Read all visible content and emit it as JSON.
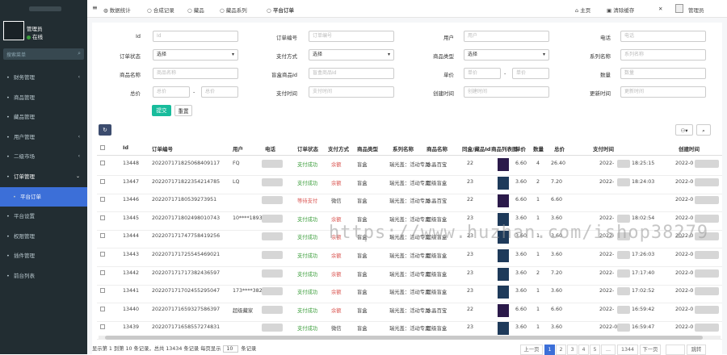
{
  "sidebar": {
    "user_name": "管理员",
    "user_status": "在线",
    "search_placeholder": "搜索菜单",
    "items": [
      {
        "label": "财务管理",
        "icon": "money-icon"
      },
      {
        "label": "商品管理",
        "icon": "goods-icon"
      },
      {
        "label": "藏品管理",
        "icon": "collection-icon"
      },
      {
        "label": "用户管理",
        "icon": "user-icon"
      },
      {
        "label": "二级市场",
        "icon": "market-icon"
      },
      {
        "label": "订单管理",
        "icon": "order-icon"
      },
      {
        "label": "平台订单",
        "icon": "circle-icon"
      },
      {
        "label": "平台设置",
        "icon": "gear-icon"
      },
      {
        "label": "权限管理",
        "icon": "lock-icon"
      },
      {
        "label": "插件管理",
        "icon": "plugin-icon"
      },
      {
        "label": "前台列表",
        "icon": "list-icon"
      }
    ]
  },
  "topbar": {
    "tabs": [
      "数据统计",
      "合成记录",
      "藏品",
      "藏品系列",
      "平台订单"
    ],
    "home": "主页",
    "clear_cache": "清除缓存",
    "admin": "管理员"
  },
  "filters": {
    "labels": [
      "Id",
      "订单编号",
      "用户",
      "电话",
      "订单状态",
      "支付方式",
      "商品类型",
      "系列名称",
      "商品名称",
      "盲盒商品Id",
      "单价",
      "数量",
      "总价",
      "支付时间",
      "创建时间",
      "更新时间"
    ],
    "placeholders": [
      "Id",
      "订单编号",
      "用户",
      "电话",
      "系列名称",
      "商品名称",
      "盲盒商品Id",
      "单价",
      "单价",
      "数量",
      "总价",
      "总价",
      "支付时间",
      "创建时间",
      "更新时间"
    ],
    "select_value": "选择",
    "search_btn": "提交",
    "reset_btn": "重置"
  },
  "table": {
    "headers": [
      "Id",
      "订单编号",
      "用户",
      "电话",
      "订单状态",
      "支付方式",
      "商品类型",
      "系列名称",
      "商品名称",
      "同盒/藏品Id",
      "商品列表图",
      "单价",
      "数量",
      "总价",
      "支付时间",
      "创建时间"
    ],
    "rows": [
      {
        "id": "13448",
        "no": "202207171825068409117",
        "user": "FQ",
        "status": "支付成功",
        "status_color": "#3c9e3c",
        "pay": "余额",
        "type": "盲盒",
        "series": "瑞光盖：活动专属",
        "name": "水晶百宝",
        "sid": "22",
        "price": "6.60",
        "qty": "4",
        "total": "26.40",
        "paytime": "2022-",
        "paytime2": "18:25:15",
        "created": "2022-0"
      },
      {
        "id": "13447",
        "no": "202207171822354214785",
        "user": "LQ",
        "status": "支付成功",
        "status_color": "#3c9e3c",
        "pay": "余额",
        "type": "盲盒",
        "series": "瑞光盖：活动专属",
        "name": "超级盲盒",
        "sid": "23",
        "price": "3.60",
        "qty": "2",
        "total": "7.20",
        "paytime": "2022-",
        "paytime2": "18:24:03",
        "created": "2022-0"
      },
      {
        "id": "13446",
        "no": "20220717180539273951",
        "user": "",
        "status": "等待支付",
        "status_color": "#d9534f",
        "pay": "微信",
        "type": "盲盒",
        "series": "瑞光盖：活动专属",
        "name": "水晶百宝",
        "sid": "22",
        "price": "6.60",
        "qty": "1",
        "total": "6.60",
        "paytime": "",
        "paytime2": "",
        "created": "2022-0"
      },
      {
        "id": "13445",
        "no": "202207171802498010743",
        "user": "10****1893",
        "status": "支付成功",
        "status_color": "#3c9e3c",
        "pay": "余额",
        "type": "盲盒",
        "series": "瑞光盖：活动专属",
        "name": "超级盲盒",
        "sid": "23",
        "price": "3.60",
        "qty": "1",
        "total": "3.60",
        "paytime": "2022-",
        "paytime2": "18:02:54",
        "created": "2022-0"
      },
      {
        "id": "13444",
        "no": "202207171747758419256",
        "user": "",
        "status": "支付成功",
        "status_color": "#3c9e3c",
        "pay": "余额",
        "type": "盲盒",
        "series": "瑞光盖：活动专属",
        "name": "超级盲盒",
        "sid": "23",
        "price": "3.60",
        "qty": "1",
        "total": "3.60",
        "paytime": "2022-",
        "paytime2": "",
        "created": "2022-0"
      },
      {
        "id": "13443",
        "no": "202207171725545469021",
        "user": "",
        "status": "支付成功",
        "status_color": "#3c9e3c",
        "pay": "余额",
        "type": "盲盒",
        "series": "瑞光盖：活动专属",
        "name": "超级盲盒",
        "sid": "23",
        "price": "3.60",
        "qty": "1",
        "total": "3.60",
        "paytime": "2022-",
        "paytime2": "17:26:03",
        "created": "2022-0"
      },
      {
        "id": "13442",
        "no": "202207171717382436597",
        "user": "",
        "status": "支付成功",
        "status_color": "#3c9e3c",
        "pay": "余额",
        "type": "盲盒",
        "series": "瑞光盖：活动专属",
        "name": "超级盲盒",
        "sid": "23",
        "price": "3.60",
        "qty": "2",
        "total": "7.20",
        "paytime": "2022-",
        "paytime2": "17:17:40",
        "created": "2022-0"
      },
      {
        "id": "13441",
        "no": "202207171702455295047",
        "user": "173****3820",
        "status": "支付成功",
        "status_color": "#3c9e3c",
        "pay": "余额",
        "type": "盲盒",
        "series": "瑞光盖：活动专属",
        "name": "超级盲盒",
        "sid": "23",
        "price": "3.60",
        "qty": "1",
        "total": "3.60",
        "paytime": "2022-",
        "paytime2": "17:02:52",
        "created": "2022-0"
      },
      {
        "id": "13440",
        "no": "202207171659327586397",
        "user": "超级藏家",
        "status": "支付成功",
        "status_color": "#3c9e3c",
        "pay": "余额",
        "type": "盲盒",
        "series": "瑞光盖：活动专属",
        "name": "水晶百宝",
        "sid": "22",
        "price": "6.60",
        "qty": "1",
        "total": "6.60",
        "paytime": "2022-",
        "paytime2": "16:59:42",
        "created": "2022-0"
      },
      {
        "id": "13439",
        "no": "202207171658557274831",
        "user": "",
        "status": "支付成功",
        "status_color": "#3c9e3c",
        "pay": "微信",
        "type": "盲盒",
        "series": "瑞光盖：活动专属",
        "name": "超级盲盒",
        "sid": "23",
        "price": "3.60",
        "qty": "1",
        "total": "3.60",
        "paytime": "2022-07-",
        "paytime2": "16:59:47",
        "created": "2022-0"
      }
    ]
  },
  "footer": {
    "summary": "显示第 1 到第 10 条记录，总共 13434 条记录 每页显示",
    "page_size": "10",
    "suffix": "条记录",
    "pages": [
      "上一页",
      "1",
      "2",
      "3",
      "4",
      "5",
      "...",
      "1344",
      "下一页"
    ],
    "goto": "跳转"
  },
  "watermark": "https://www.huzhan.com/ishop38279"
}
